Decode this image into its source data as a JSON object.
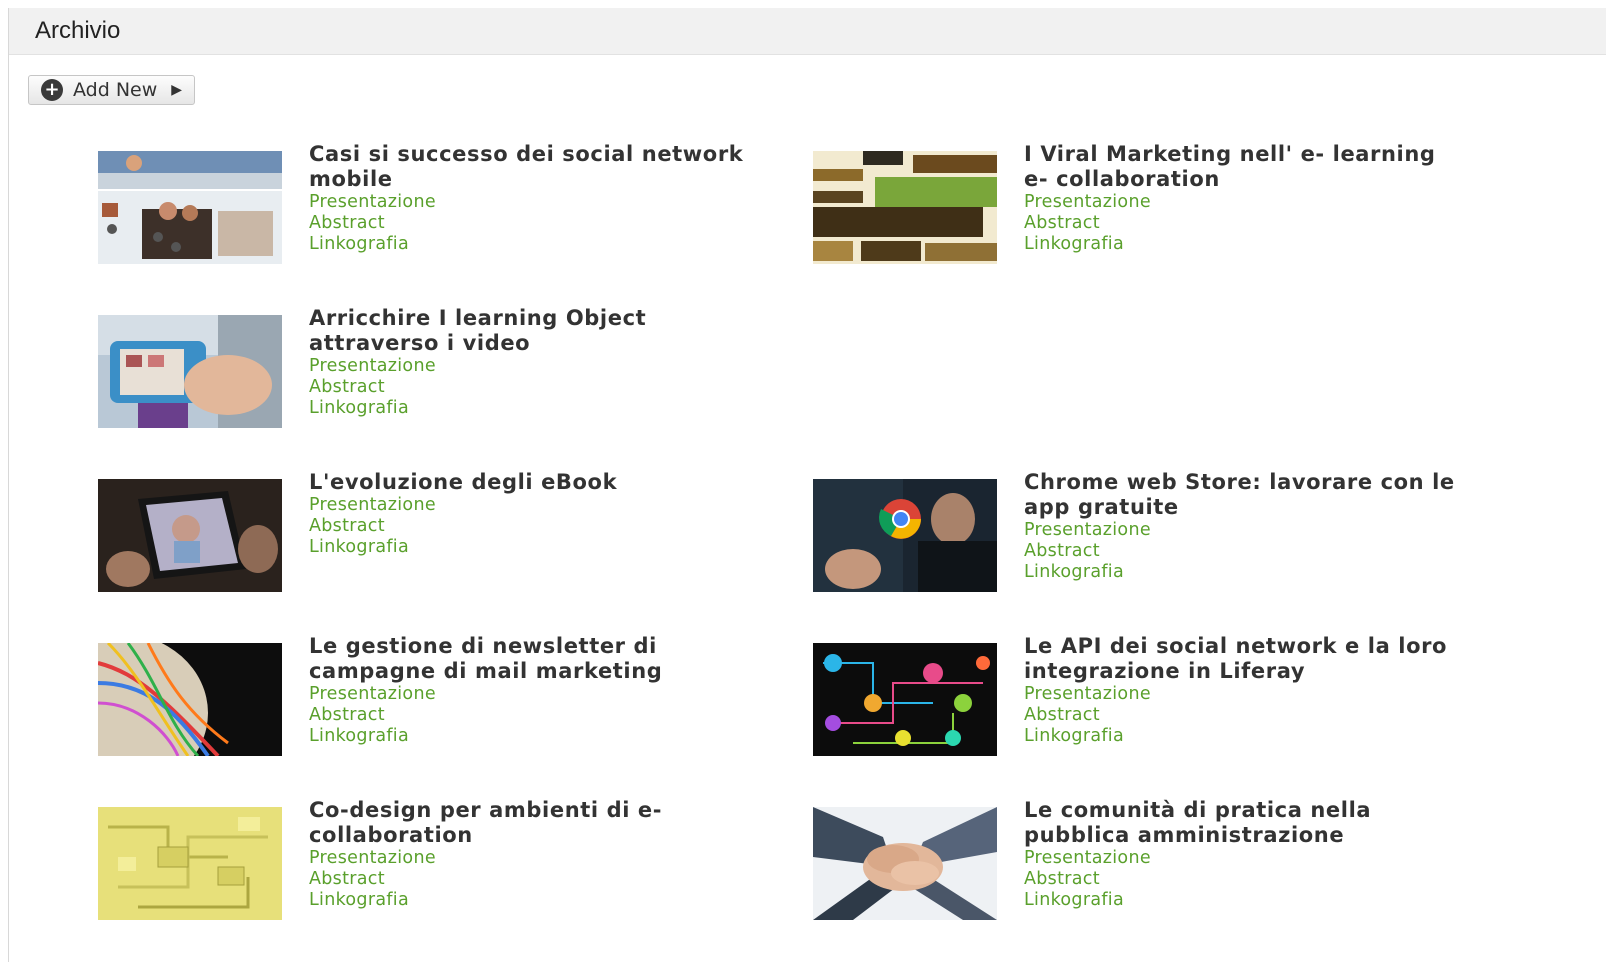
{
  "panel": {
    "title": "Archivio"
  },
  "toolbar": {
    "add_new_label": "Add New"
  },
  "links": {
    "presentazione": "Presentazione",
    "abstract": "Abstract",
    "linkografia": "Linkografia"
  },
  "colors": {
    "link": "#5aa02c",
    "title": "#333333",
    "header_bg": "#f1f1f1"
  },
  "items": [
    {
      "title": "Casi si successo dei social network mobile",
      "thumb": "social-network-mobile-image"
    },
    {
      "title": "I Viral Marketing nell' e- learning e- collaboration",
      "thumb": "viral-marketing-word-cloud-image"
    },
    {
      "title": "Arricchire I learning Object attraverso i video",
      "thumb": "smartphone-video-image"
    },
    {
      "title": "L'evoluzione degli eBook",
      "thumb": "tablet-ebook-image"
    },
    {
      "title": "Chrome web Store: lavorare con le app gratuite",
      "thumb": "chrome-logo-man-image"
    },
    {
      "title": "Le gestione di newsletter di campagne di mail marketing",
      "thumb": "colored-cables-globe-image"
    },
    {
      "title": "Le API dei social network e la loro integrazione in Liferay",
      "thumb": "social-network-icons-image"
    },
    {
      "title": "Co-design per ambienti di e-collaboration",
      "thumb": "yellow-circuit-image"
    },
    {
      "title": "Le comunità di pratica nella pubblica amministrazione",
      "thumb": "teamwork-hands-image"
    }
  ]
}
